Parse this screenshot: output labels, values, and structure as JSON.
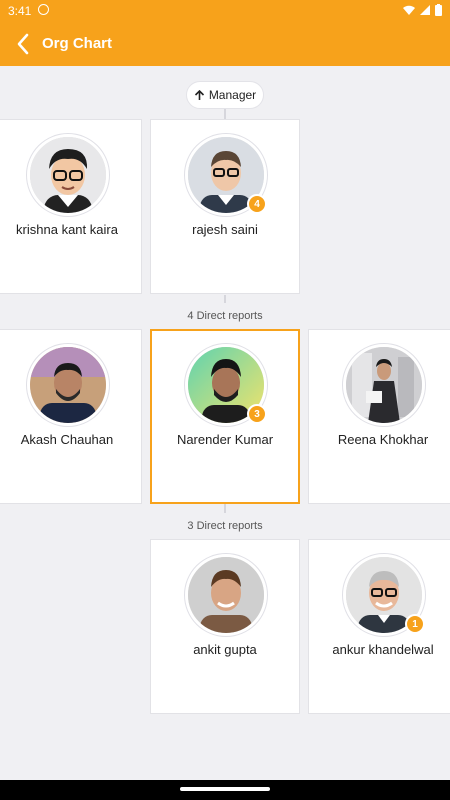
{
  "status": {
    "time": "3:41"
  },
  "appbar": {
    "title": "Org Chart"
  },
  "manager_button": {
    "label": "Manager"
  },
  "managers": [
    {
      "name": "krishna kant kaira"
    },
    {
      "name": "rajesh saini",
      "count": "4"
    }
  ],
  "direct_reports_label": "4 Direct reports",
  "peers": [
    {
      "name": "Akash Chauhan"
    },
    {
      "name": "Narender Kumar",
      "count": "3"
    },
    {
      "name": "Reena Khokhar"
    }
  ],
  "sub_reports_label": "3 Direct reports",
  "reports": [
    {
      "name": "ankit gupta"
    },
    {
      "name": "ankur khandelwal",
      "count": "1"
    }
  ],
  "colors": {
    "accent": "#f7a21b",
    "background": "#f0f0f3",
    "card": "#ffffff"
  }
}
